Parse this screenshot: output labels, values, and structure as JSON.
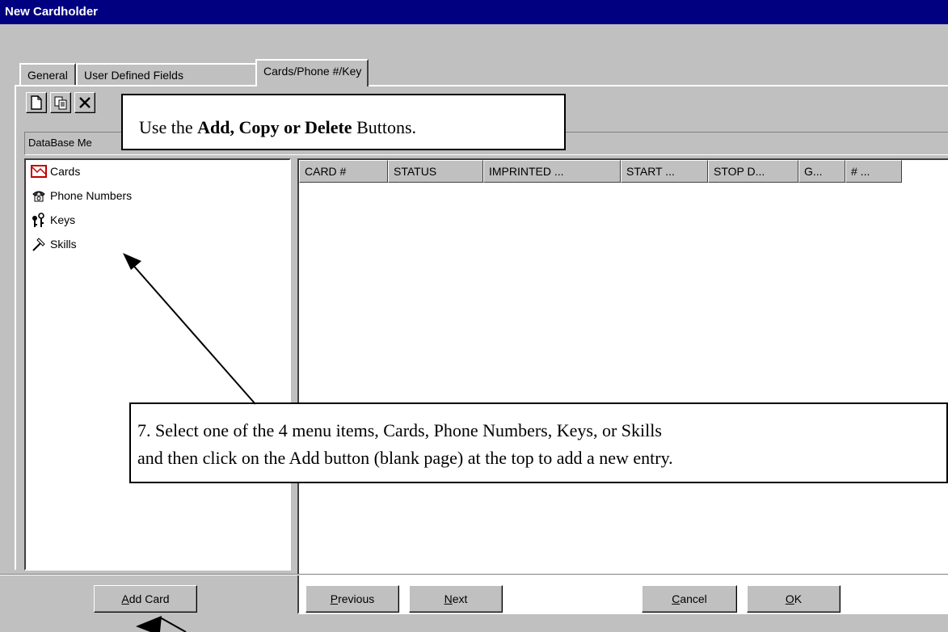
{
  "window": {
    "title": "New Cardholder"
  },
  "tabs": [
    {
      "label": "General"
    },
    {
      "label": "User Defined Fields"
    },
    {
      "label": "Cards/Phone #/Key"
    }
  ],
  "toolbar": {
    "add": {
      "icon": "blank-page-icon"
    },
    "copy": {
      "icon": "copy-icon"
    },
    "delete": {
      "icon": "delete-x-icon"
    }
  },
  "section_header": "DataBase Me",
  "tree": {
    "items": [
      {
        "label": "Cards",
        "icon": "card-icon"
      },
      {
        "label": "Phone Numbers",
        "icon": "telephone-icon"
      },
      {
        "label": "Keys",
        "icon": "keys-icon"
      },
      {
        "label": "Skills",
        "icon": "hammer-icon"
      }
    ]
  },
  "grid": {
    "columns": [
      "CARD #",
      "STATUS",
      "IMPRINTED ...",
      "START ...",
      "STOP D...",
      "G...",
      "# ..."
    ]
  },
  "callouts": {
    "top": {
      "prefix": "Use the ",
      "bold1": "Add, Copy or Delete",
      "suffix": " Buttons."
    },
    "bottom": {
      "line1": "7.   Select one of the 4 menu items, Cards, Phone Numbers, Keys, or Skills",
      "line2": "and then click on the Add button (blank page) at the top to add a new entry."
    }
  },
  "buttons": {
    "add_card": {
      "accel": "A",
      "rest": "dd Card"
    },
    "previous": {
      "accel": "P",
      "rest": "revious"
    },
    "next": {
      "accel": "N",
      "rest": "ext"
    },
    "cancel": {
      "accel": "C",
      "rest": "ancel"
    },
    "ok": {
      "accel": "O",
      "rest": "K"
    }
  },
  "colors": {
    "titlebar": "#000080",
    "face": "#c0c0c0",
    "shadow": "#808080",
    "highlight": "#ffffff"
  }
}
